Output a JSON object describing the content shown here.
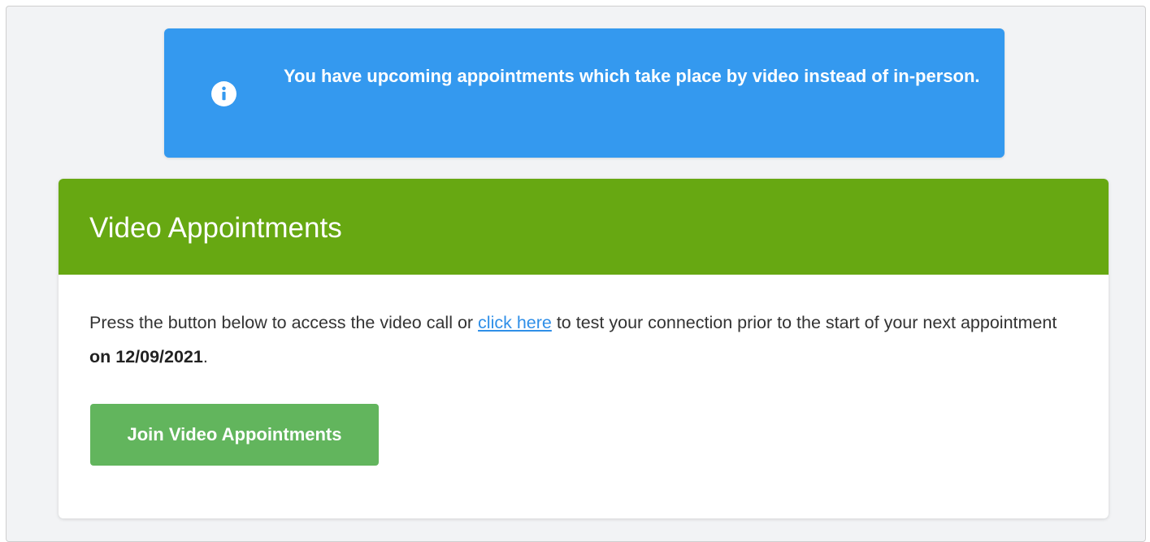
{
  "notice": {
    "icon": "info-circle-icon",
    "text": "You have upcoming appointments which take place by video instead of in-person."
  },
  "video_card": {
    "title": "Video Appointments",
    "body_prefix": "Press the button below to access the video call or ",
    "link_text": "click here",
    "body_middle": " to test your connection prior to the start of your next appointment ",
    "body_date": "on 12/09/2021",
    "body_suffix": ".",
    "join_button_label": "Join Video Appointments"
  },
  "colors": {
    "notice_background": "#3499ef",
    "card_header_background": "#67a812",
    "join_button_background": "#62b55d",
    "link": "#2f8fe8"
  }
}
